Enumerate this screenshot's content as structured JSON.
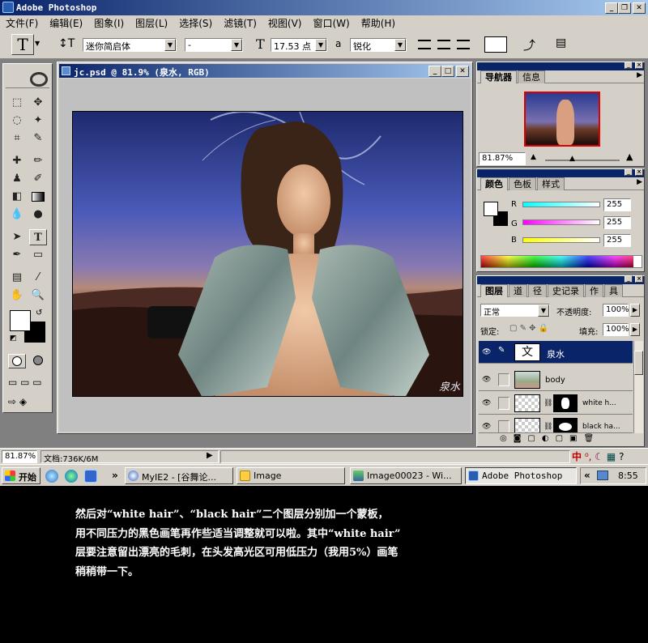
{
  "app": {
    "title": "Adobe Photoshop"
  },
  "menu": [
    "文件(F)",
    "编辑(E)",
    "图象(I)",
    "图层(L)",
    "选择(S)",
    "滤镜(T)",
    "视图(V)",
    "窗口(W)",
    "帮助(H)"
  ],
  "options": {
    "tool_glyph": "T",
    "font_family": "迷你简启体",
    "font_style": "-",
    "font_size": "17.53 点",
    "aa_glyph": "a",
    "antialias": "锐化"
  },
  "document": {
    "title": "jc.psd @ 81.9% (泉水, RGB)",
    "signature": "泉水"
  },
  "navigator": {
    "tabs": [
      "导航器",
      "信息"
    ],
    "zoom": "81.87%"
  },
  "color": {
    "tabs": [
      "颜色",
      "色板",
      "样式"
    ],
    "r_label": "R",
    "g_label": "G",
    "b_label": "B",
    "r": "255",
    "g": "255",
    "b": "255"
  },
  "layers": {
    "tabs": [
      "图层",
      "道",
      "径",
      "史记录",
      "作",
      "具"
    ],
    "blend_mode": "正常",
    "opacity_label": "不透明度:",
    "opacity": "100%",
    "lock_label": "锁定:",
    "fill_label": "填充:",
    "fill": "100%",
    "items": [
      {
        "name": "泉水",
        "selected": true,
        "thumb_glyph": "文"
      },
      {
        "name": "body",
        "selected": false
      },
      {
        "name": "white h...",
        "selected": false
      },
      {
        "name": "black ha...",
        "selected": false
      }
    ]
  },
  "status": {
    "zoom": "81.87%",
    "doc": "文档:736K/6M"
  },
  "taskbar": {
    "start": "开始",
    "chevron": "»",
    "items": [
      "MyIE2 - [谷舞论...",
      "Image",
      "Image00023 - Wi...",
      "Adobe Photoshop"
    ],
    "tray_chevron": "«",
    "time": "8:55",
    "ime": "中"
  },
  "caption": {
    "lines": [
      "然后对“white hair”、“black hair”二个图层分别加一个蒙板，",
      "用不同压力的黑色画笔再作些适当调整就可以啦。其中“white hair”",
      "层要注意留出漂亮的毛刺，在头发高光区可用低压力（我用5%）画笔",
      "稍稍带一下。"
    ]
  }
}
